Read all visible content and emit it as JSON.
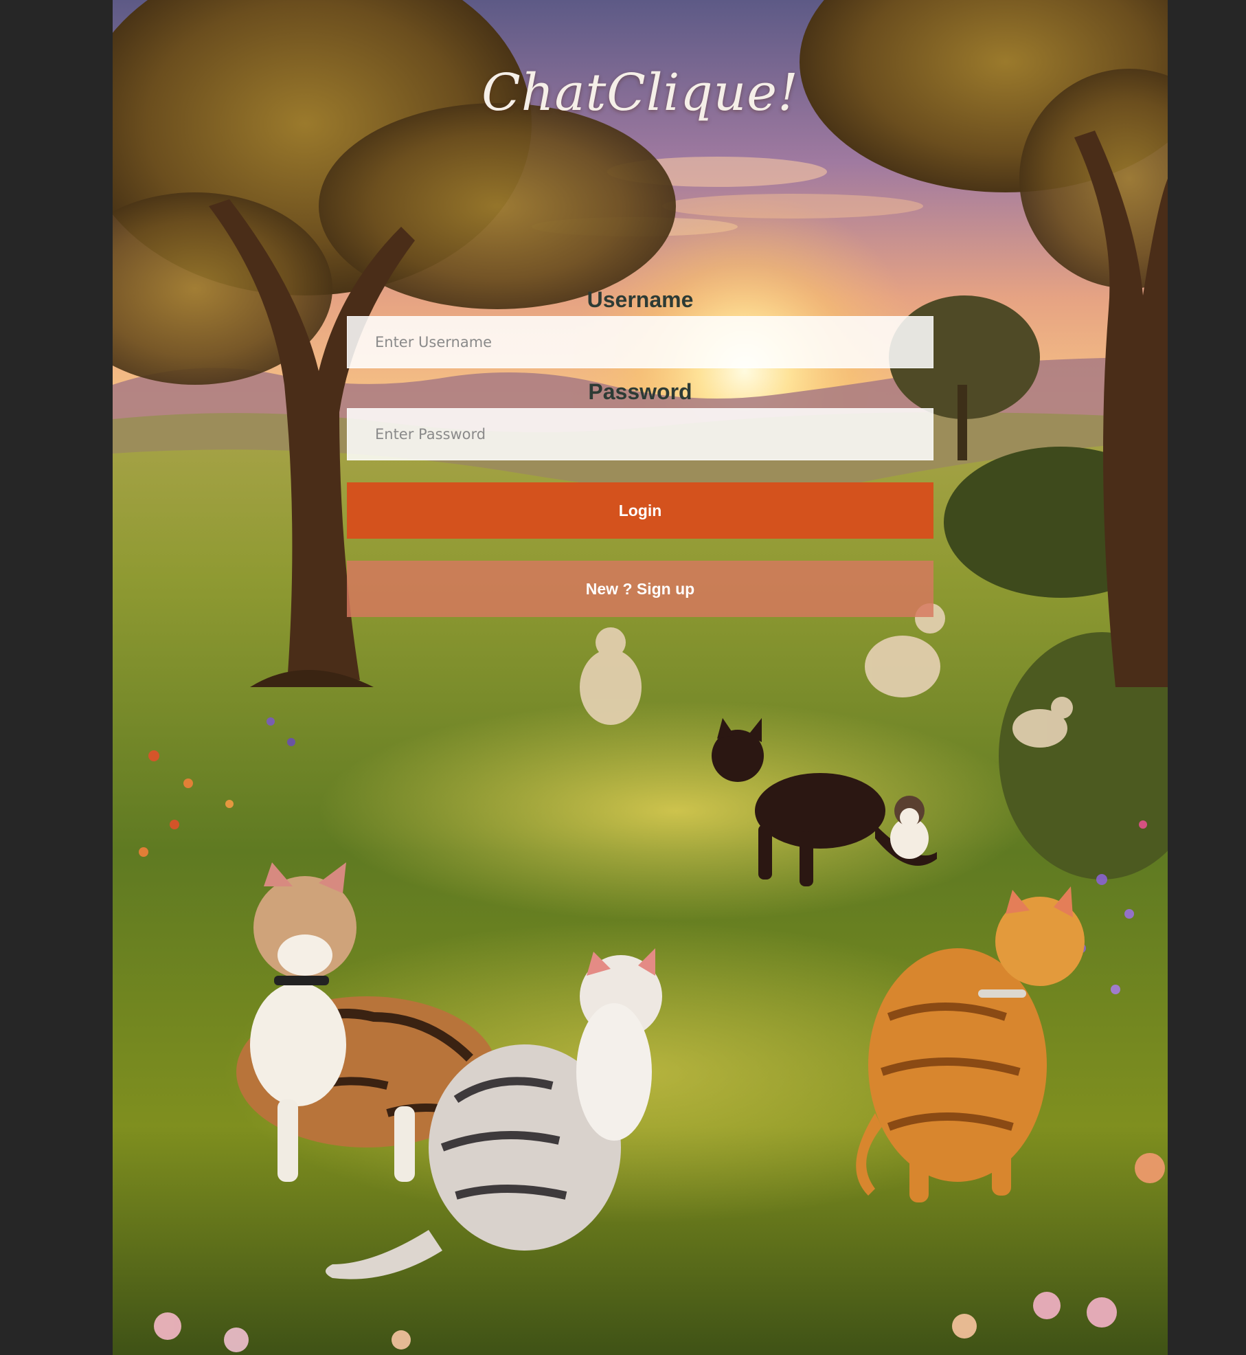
{
  "app": {
    "title": "ChatClique!"
  },
  "login_form": {
    "username_label": "Username",
    "username_placeholder": "Enter Username",
    "username_value": "",
    "password_label": "Password",
    "password_placeholder": "Enter Password",
    "password_value": "",
    "login_label": "Login",
    "signup_label": "New ? Sign up"
  },
  "colors": {
    "page_background": "#262626",
    "login_button": "#d4521d",
    "signup_button": "#d7785f",
    "label_text": "#2d3b35",
    "title_text": "#f5efe8"
  }
}
